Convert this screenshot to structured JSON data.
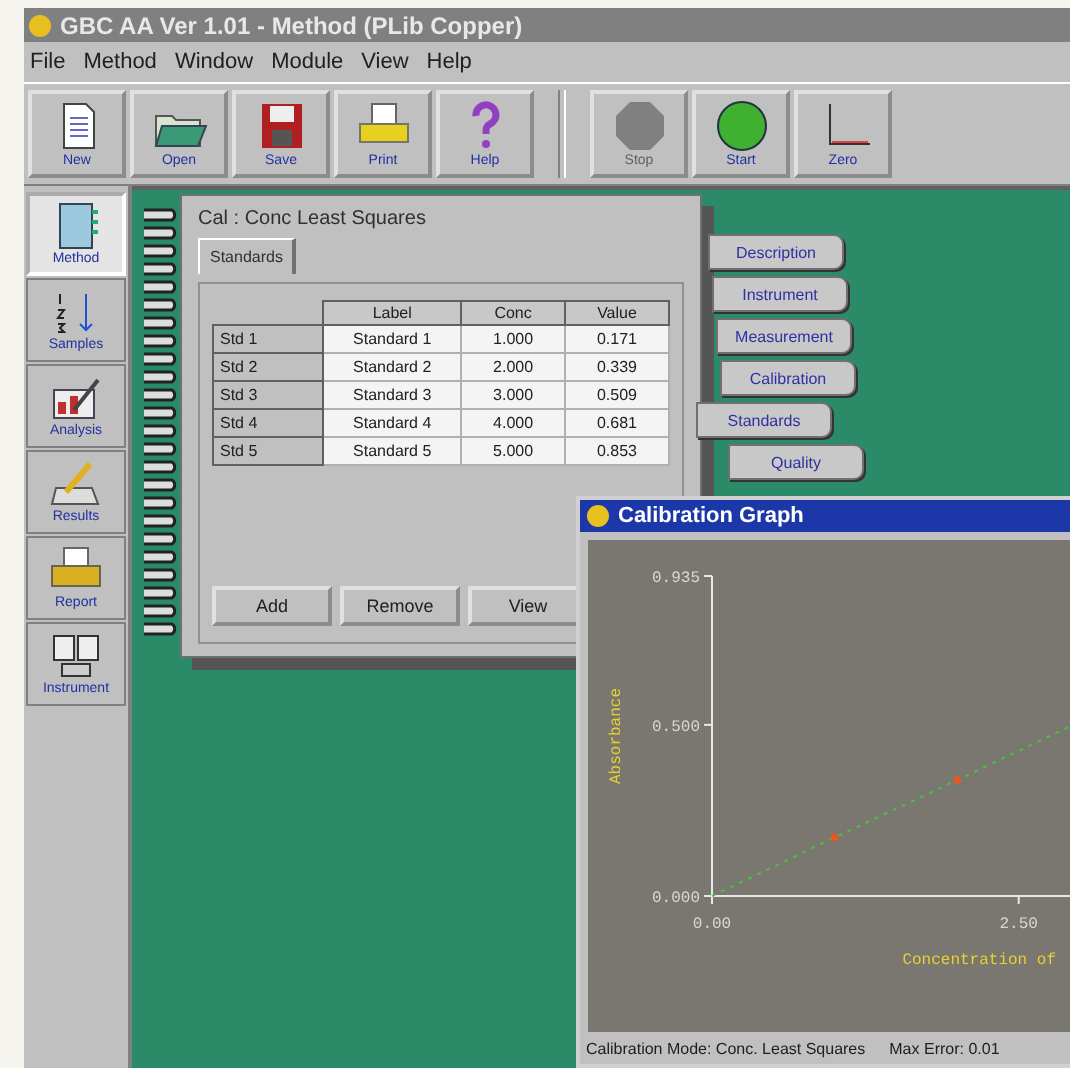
{
  "window": {
    "title": "GBC AA Ver 1.01 - Method (PLib Copper)"
  },
  "menu": [
    "File",
    "Method",
    "Window",
    "Module",
    "View",
    "Help"
  ],
  "toolbar": [
    {
      "label": "New",
      "kind": "new",
      "disabled": false
    },
    {
      "label": "Open",
      "kind": "open",
      "disabled": false
    },
    {
      "label": "Save",
      "kind": "save",
      "disabled": false
    },
    {
      "label": "Print",
      "kind": "print",
      "disabled": false
    },
    {
      "label": "Help",
      "kind": "help",
      "disabled": false
    },
    {
      "label": "Stop",
      "kind": "stop",
      "disabled": true
    },
    {
      "label": "Start",
      "kind": "start",
      "disabled": false
    },
    {
      "label": "Zero",
      "kind": "zero",
      "disabled": false
    }
  ],
  "sidebar": {
    "items": [
      {
        "label": "Method",
        "kind": "method",
        "selected": true
      },
      {
        "label": "Samples",
        "kind": "samples",
        "selected": false
      },
      {
        "label": "Analysis",
        "kind": "analysis",
        "selected": false
      },
      {
        "label": "Results",
        "kind": "results",
        "selected": false
      },
      {
        "label": "Report",
        "kind": "report",
        "selected": false
      },
      {
        "label": "Instrument",
        "kind": "instrument",
        "selected": false
      }
    ]
  },
  "method_window": {
    "title": "Cal : Conc Least Squares",
    "tab": "Standards",
    "table": {
      "columns": [
        "Label",
        "Conc",
        "Value"
      ],
      "rows": [
        {
          "name": "Std 1",
          "cells": [
            "Standard 1",
            "1.000",
            "0.171"
          ]
        },
        {
          "name": "Std 2",
          "cells": [
            "Standard 2",
            "2.000",
            "0.339"
          ]
        },
        {
          "name": "Std 3",
          "cells": [
            "Standard 3",
            "3.000",
            "0.509"
          ]
        },
        {
          "name": "Std 4",
          "cells": [
            "Standard 4",
            "4.000",
            "0.681"
          ]
        },
        {
          "name": "Std 5",
          "cells": [
            "Standard 5",
            "5.000",
            "0.853"
          ]
        }
      ]
    },
    "buttons": [
      "Add",
      "Remove",
      "View"
    ],
    "side_tabs": [
      {
        "label": "Description",
        "selected": false
      },
      {
        "label": "Instrument",
        "selected": false
      },
      {
        "label": "Measurement",
        "selected": false
      },
      {
        "label": "Calibration",
        "selected": false
      },
      {
        "label": "Standards",
        "selected": true
      },
      {
        "label": "Quality",
        "selected": false
      }
    ]
  },
  "graph_window": {
    "title": "Calibration Graph",
    "chart_data": {
      "type": "scatter",
      "xlabel": "Concentration of",
      "ylabel": "Absorbance",
      "x": [
        0,
        1,
        2,
        3
      ],
      "series": [
        {
          "color": "#e05a28",
          "values": [
            null,
            0.171,
            0.339,
            null
          ]
        },
        {
          "type": "line",
          "line_style": "dashed",
          "color": "#4cc040",
          "values": [
            0,
            0.171,
            0.339,
            0.509
          ]
        }
      ],
      "xlim": [
        0,
        3
      ],
      "ylim": [
        0,
        0.935
      ],
      "xticks": [
        {
          "value": 0,
          "label": "0.00"
        },
        {
          "value": 2.5,
          "label": "2.50"
        }
      ],
      "yticks": [
        {
          "value": 0,
          "label": "0.000"
        },
        {
          "value": 0.5,
          "label": "0.500"
        },
        {
          "value": 0.935,
          "label": "0.935"
        }
      ]
    },
    "status": [
      "Calibration Mode: Conc. Least Squares",
      "Max Error: 0.01"
    ]
  }
}
